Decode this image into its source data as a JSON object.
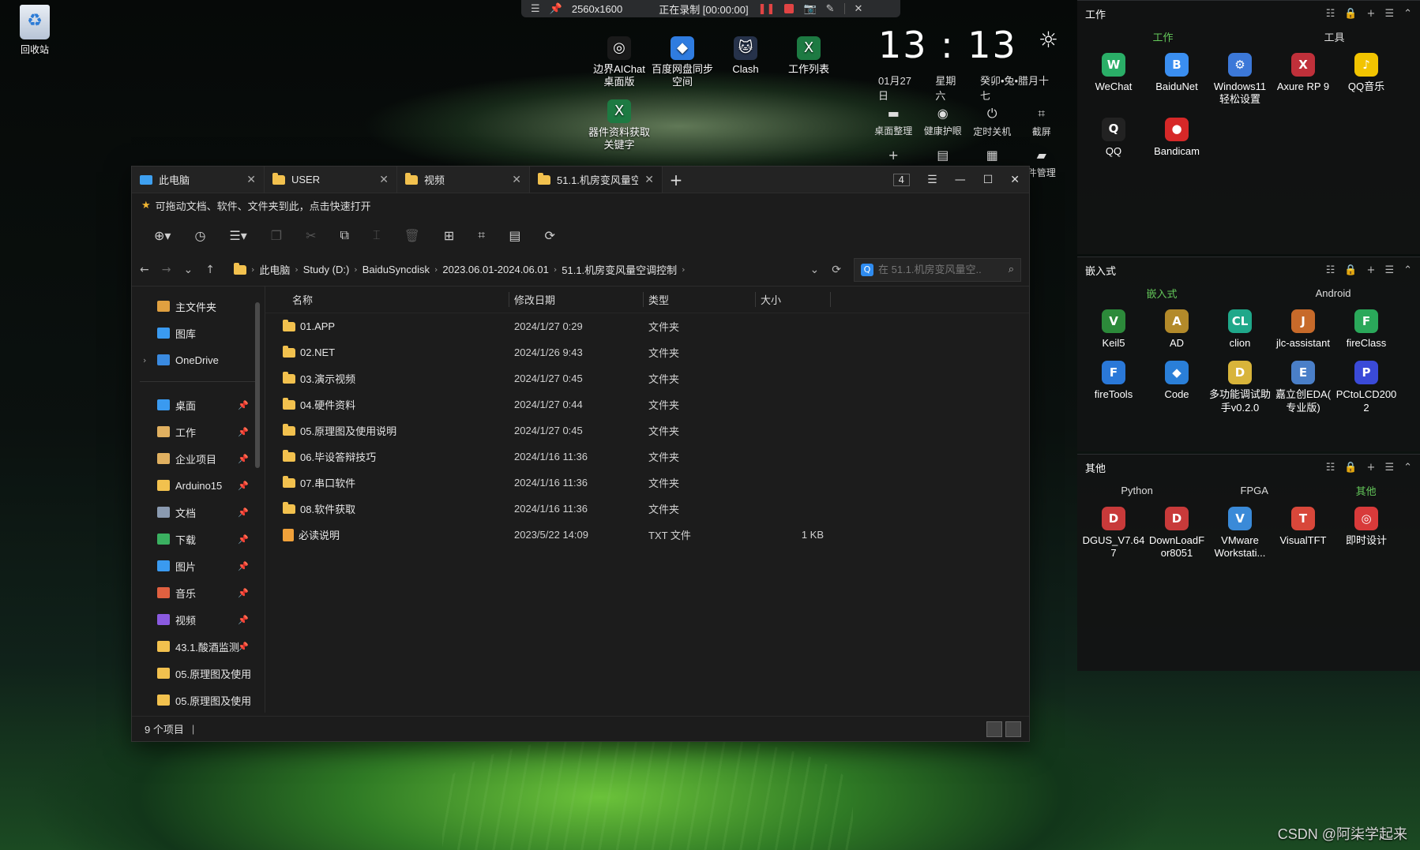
{
  "desktop": {
    "recycle_bin": "回收站",
    "shortcuts": [
      {
        "label": "边界AIChat\n桌面版",
        "icon": "aichat-icon"
      },
      {
        "label": "百度网盘同步\n空间",
        "icon": "baidu-sync-icon"
      },
      {
        "label": "Clash",
        "icon": "clash-icon"
      },
      {
        "label": "工作列表",
        "icon": "excel-icon"
      },
      {
        "label": "器件资料获取\n关键字",
        "icon": "excel-icon"
      }
    ],
    "watermark": "CSDN @阿柒学起来"
  },
  "recorder": {
    "resolution": "2560x1600",
    "status": "正在录制 [00:00:00]"
  },
  "clock": {
    "time": "13 : 13",
    "date": "01月27日",
    "weekday": "星期六",
    "lunar": "癸卯•兔•腊月十七",
    "quick_actions": [
      "桌面整理",
      "健康护眼",
      "定时关机",
      "截屏",
      "",
      "",
      "",
      "件管理"
    ]
  },
  "fences": [
    {
      "title": "工作",
      "tabs": [
        "工作",
        "工具"
      ],
      "active_tab": 0,
      "apps": [
        {
          "label": "WeChat",
          "color": "#2aae67",
          "glyph": "W"
        },
        {
          "label": "BaiduNet",
          "color": "#3a8ef0",
          "glyph": "B"
        },
        {
          "label": "Windows11\n轻松设置",
          "color": "#3c78d8",
          "glyph": "⚙"
        },
        {
          "label": "Axure RP 9",
          "color": "#c0303a",
          "glyph": "X"
        },
        {
          "label": "QQ音乐",
          "color": "#f2c400",
          "glyph": "♪"
        },
        {
          "label": "QQ",
          "color": "#222",
          "glyph": "Q"
        },
        {
          "label": "Bandicam",
          "color": "#d62828",
          "glyph": "●"
        }
      ]
    },
    {
      "title": "嵌入式",
      "tabs": [
        "嵌入式",
        "Android"
      ],
      "active_tab": 0,
      "apps": [
        {
          "label": "Keil5",
          "color": "#2c8a3a",
          "glyph": "V"
        },
        {
          "label": "AD",
          "color": "#b38a2a",
          "glyph": "A"
        },
        {
          "label": "clion",
          "color": "#1fa88a",
          "glyph": "CL"
        },
        {
          "label": "jlc-assistant",
          "color": "#c76a2a",
          "glyph": "J"
        },
        {
          "label": "fireClass",
          "color": "#2aa85a",
          "glyph": "F"
        },
        {
          "label": "fireTools",
          "color": "#2a78d8",
          "glyph": "F"
        },
        {
          "label": "Code",
          "color": "#2a7fd8",
          "glyph": "◆"
        },
        {
          "label": "多功能调试助\n手v0.2.0",
          "color": "#d8b43a",
          "glyph": "D"
        },
        {
          "label": "嘉立创EDA(\n专业版)",
          "color": "#4a7fc8",
          "glyph": "E"
        },
        {
          "label": "PCtoLCD200\n2",
          "color": "#3a4ad8",
          "glyph": "P"
        }
      ]
    },
    {
      "title": "其他",
      "tabs": [
        "Python",
        "FPGA",
        "其他"
      ],
      "active_tab": 2,
      "apps": [
        {
          "label": "DGUS_V7.64\n7",
          "color": "#c83a3a",
          "glyph": "D"
        },
        {
          "label": "DownLoadF\nor8051",
          "color": "#c83a3a",
          "glyph": "D"
        },
        {
          "label": "VMware\nWorkstati...",
          "color": "#3a8ad8",
          "glyph": "V"
        },
        {
          "label": "VisualTFT",
          "color": "#d8473a",
          "glyph": "T"
        },
        {
          "label": "即时设计",
          "color": "#d83a3a",
          "glyph": "◎"
        }
      ]
    }
  ],
  "explorer": {
    "tabs": [
      {
        "label": "此电脑",
        "icon": "pc"
      },
      {
        "label": "USER",
        "icon": "folder"
      },
      {
        "label": "视频",
        "icon": "folder"
      },
      {
        "label": "51.1.机房变风量空",
        "icon": "folder"
      }
    ],
    "active_tab": 3,
    "tab_count": "4",
    "hint": "可拖动文档、软件、文件夹到此，点击快速打开",
    "breadcrumb": [
      "此电脑",
      "Study (D:)",
      "BaiduSyncdisk",
      "2023.06.01-2024.06.01",
      "51.1.机房变风量空调控制"
    ],
    "search_placeholder": "在 51.1.机房变风量空...",
    "nav": [
      {
        "label": "主文件夹",
        "color": "#e0a040",
        "pin": false
      },
      {
        "label": "图库",
        "color": "#3a9af0",
        "pin": false
      },
      {
        "label": "OneDrive",
        "color": "#3a8ae0",
        "pin": false,
        "expand": true
      },
      {
        "label": "桌面",
        "color": "#3a9af0",
        "pin": true
      },
      {
        "label": "工作",
        "color": "#e0b060",
        "pin": true
      },
      {
        "label": "企业项目",
        "color": "#e0b060",
        "pin": true
      },
      {
        "label": "Arduino15",
        "color": "#f2c14e",
        "pin": true
      },
      {
        "label": "文档",
        "color": "#8a9ab0",
        "pin": true
      },
      {
        "label": "下载",
        "color": "#3ab060",
        "pin": true
      },
      {
        "label": "图片",
        "color": "#3a9af0",
        "pin": true
      },
      {
        "label": "音乐",
        "color": "#e06040",
        "pin": true
      },
      {
        "label": "视频",
        "color": "#8a5ae0",
        "pin": true
      },
      {
        "label": "43.1.酸酒监测",
        "color": "#f2c14e",
        "pin": true
      },
      {
        "label": "05.原理图及使用",
        "color": "#f2c14e",
        "pin": false
      },
      {
        "label": "05.原理图及使用",
        "color": "#f2c14e",
        "pin": false
      }
    ],
    "columns": [
      "名称",
      "修改日期",
      "类型",
      "大小"
    ],
    "files": [
      {
        "name": "01.APP",
        "date": "2024/1/27 0:29",
        "type": "文件夹",
        "size": "",
        "kind": "folder"
      },
      {
        "name": "02.NET",
        "date": "2024/1/26 9:43",
        "type": "文件夹",
        "size": "",
        "kind": "folder"
      },
      {
        "name": "03.演示视频",
        "date": "2024/1/27 0:45",
        "type": "文件夹",
        "size": "",
        "kind": "folder"
      },
      {
        "name": "04.硬件资料",
        "date": "2024/1/27 0:44",
        "type": "文件夹",
        "size": "",
        "kind": "folder"
      },
      {
        "name": "05.原理图及使用说明",
        "date": "2024/1/27 0:45",
        "type": "文件夹",
        "size": "",
        "kind": "folder"
      },
      {
        "name": "06.毕设答辩技巧",
        "date": "2024/1/16 11:36",
        "type": "文件夹",
        "size": "",
        "kind": "folder"
      },
      {
        "name": "07.串口软件",
        "date": "2024/1/16 11:36",
        "type": "文件夹",
        "size": "",
        "kind": "folder"
      },
      {
        "name": "08.软件获取",
        "date": "2024/1/16 11:36",
        "type": "文件夹",
        "size": "",
        "kind": "folder"
      },
      {
        "name": "必读说明",
        "date": "2023/5/22 14:09",
        "type": "TXT 文件",
        "size": "1 KB",
        "kind": "txt"
      }
    ],
    "status": "9 个项目"
  }
}
